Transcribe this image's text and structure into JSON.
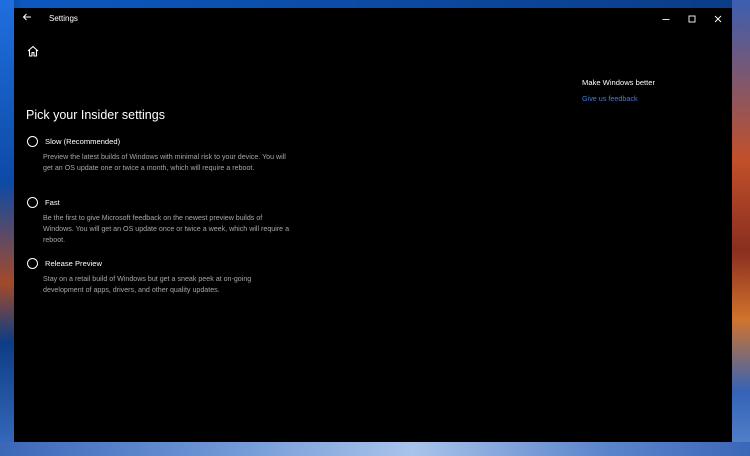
{
  "window": {
    "title": "Settings",
    "back_icon": "back-arrow-icon",
    "minimize_icon": "minimize-icon",
    "maximize_icon": "maximize-icon",
    "close_icon": "close-icon"
  },
  "home_icon": "home-icon",
  "page": {
    "title": "Pick your Insider settings",
    "options": [
      {
        "label": "Slow (Recommended)",
        "description": "Preview the latest builds of Windows with minimal risk to your device. You will get an OS update one or twice a month, which will require a reboot."
      },
      {
        "label": "Fast",
        "description": "Be the first to give Microsoft feedback on the newest preview builds of Windows. You will get an OS update once or twice a week, which will require a reboot."
      },
      {
        "label": "Release Preview",
        "description": "Stay on a retail build of Windows but get a sneak peek at on-going development of apps, drivers, and other quality updates."
      }
    ]
  },
  "side": {
    "title": "Make Windows better",
    "link": "Give us feedback"
  },
  "colors": {
    "window_bg": "#000000",
    "text": "#ffffff",
    "secondary_text": "#a6a6a6",
    "link": "#4a7ad6"
  }
}
